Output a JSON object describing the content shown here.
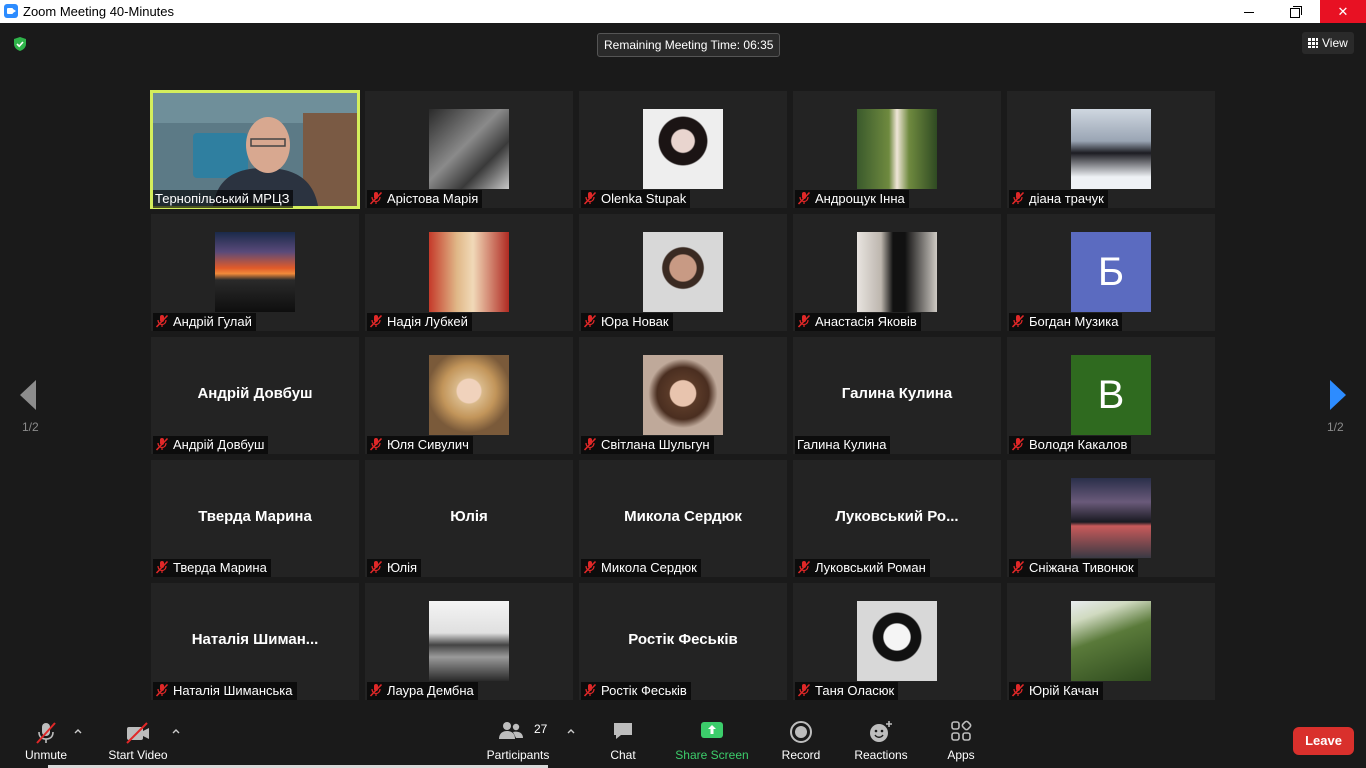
{
  "window": {
    "title": "Zoom Meeting 40-Minutes"
  },
  "top": {
    "remaining_time": "Remaining Meeting Time: 06:35",
    "view_label": "View"
  },
  "paging": {
    "left_label": "1/2",
    "right_label": "1/2"
  },
  "colors": {
    "accent_blue": "#2d8cff",
    "active_speaker": "#d4ee5c",
    "leave_red": "#d9302c",
    "share_green": "#3ccd6b",
    "mute_red": "#e02828"
  },
  "participants": [
    {
      "name": "Тернопільський МРЦЗ",
      "kind": "video",
      "muted": false,
      "active": true
    },
    {
      "name": "Арістова Марія",
      "kind": "photo",
      "muted": true,
      "photo": "bw-portrait"
    },
    {
      "name": "Olenka Stupak",
      "kind": "photo",
      "muted": true,
      "photo": "girl-dark-hair"
    },
    {
      "name": "Андрощук Інна",
      "kind": "photo",
      "muted": true,
      "photo": "girl-garden"
    },
    {
      "name": "діана трачук",
      "kind": "photo",
      "muted": true,
      "photo": "girl-snow"
    },
    {
      "name": "Андрій Гулай",
      "kind": "photo",
      "muted": true,
      "photo": "sunset"
    },
    {
      "name": "Надія Лубкей",
      "kind": "photo",
      "muted": true,
      "photo": "blonde-woman"
    },
    {
      "name": "Юра Новак",
      "kind": "photo",
      "muted": true,
      "photo": "boy-portrait"
    },
    {
      "name": "Анастасія Яковів",
      "kind": "photo",
      "muted": true,
      "photo": "girl-hall"
    },
    {
      "name": "Богдан Музика",
      "kind": "letter",
      "letter": "Б",
      "color": "#5b6bc0",
      "muted": true
    },
    {
      "name": "Андрій Довбуш",
      "kind": "text",
      "display": "Андрій Довбуш",
      "muted": true
    },
    {
      "name": "Юля Сивулич",
      "kind": "photo",
      "muted": true,
      "photo": "girl-blonde"
    },
    {
      "name": "Світлана Шульгун",
      "kind": "photo",
      "muted": true,
      "photo": "girl-brunette"
    },
    {
      "name": "Галина Кулина",
      "kind": "text",
      "display": "Галина Кулина",
      "muted": false
    },
    {
      "name": "Володя Какалов",
      "kind": "letter",
      "letter": "В",
      "color": "#2f6a1f",
      "muted": true
    },
    {
      "name": "Тверда Марина",
      "kind": "text",
      "display": "Тверда Марина",
      "muted": true
    },
    {
      "name": "Юлія",
      "kind": "text",
      "display": "Юлія",
      "muted": true
    },
    {
      "name": "Микола Сердюк",
      "kind": "text",
      "display": "Микола Сердюк",
      "muted": true
    },
    {
      "name": "Луковський Роман",
      "kind": "text",
      "display": "Луковський  Ро...",
      "muted": true
    },
    {
      "name": "Сніжана Тивонюк",
      "kind": "photo",
      "muted": true,
      "photo": "girl-street"
    },
    {
      "name": "Наталія Шиманська",
      "kind": "text",
      "display": "Наталія  Шиман...",
      "muted": true
    },
    {
      "name": "Лаура Дембна",
      "kind": "photo",
      "muted": true,
      "photo": "bw-lake"
    },
    {
      "name": "Ростік Феськів",
      "kind": "text",
      "display": "Ростік Феськів",
      "muted": true
    },
    {
      "name": "Таня Оласюк",
      "kind": "photo",
      "muted": true,
      "photo": "manga"
    },
    {
      "name": "Юрій Качан",
      "kind": "photo",
      "muted": true,
      "photo": "grass"
    }
  ],
  "toolbar": {
    "unmute": "Unmute",
    "start_video": "Start Video",
    "participants": "Participants",
    "participants_count": "27",
    "chat": "Chat",
    "share_screen": "Share Screen",
    "record": "Record",
    "reactions": "Reactions",
    "apps": "Apps",
    "leave": "Leave"
  }
}
